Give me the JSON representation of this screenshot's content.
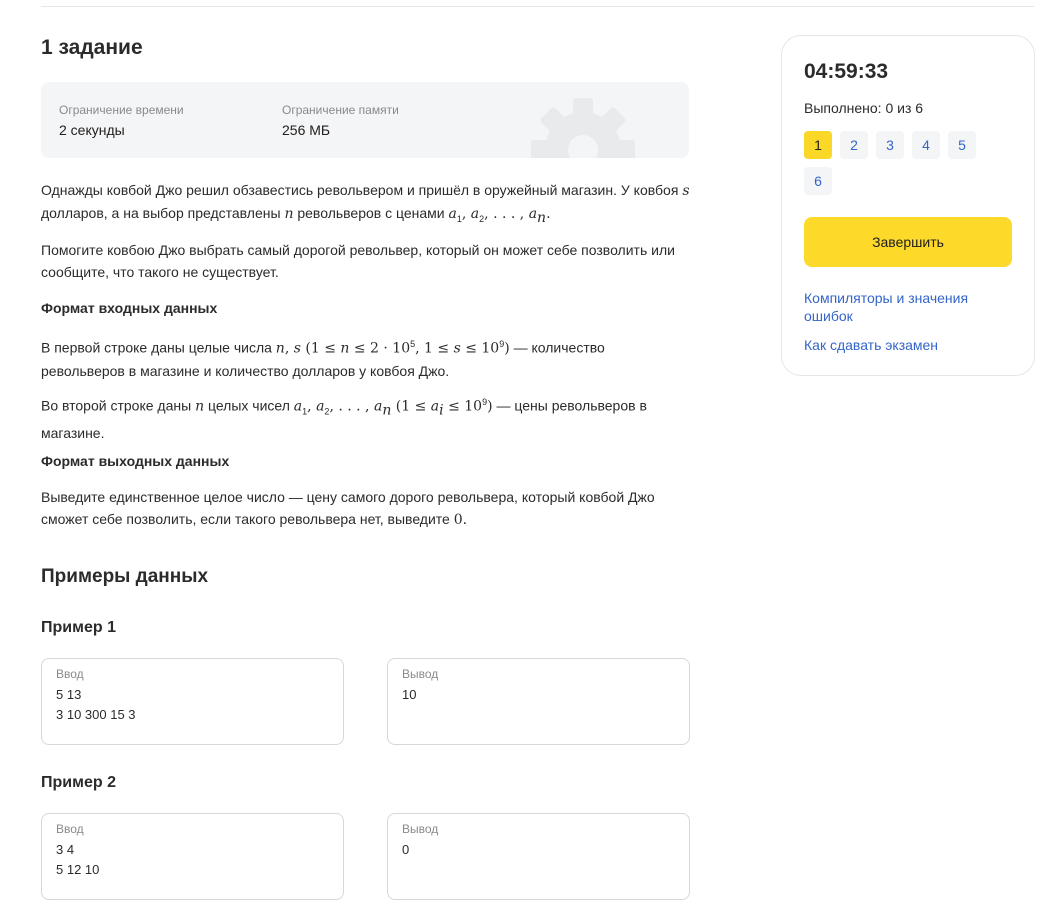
{
  "task": {
    "title": "1 задание",
    "limits": {
      "time_label": "Ограничение времени",
      "time_value": "2 секунды",
      "memory_label": "Ограничение памяти",
      "memory_value": "256 МБ"
    }
  },
  "statement": {
    "p1_a": "Однажды ковбой Джо решил обзавестись револьвером и пришёл в оружейный магазин. У ковбоя ",
    "p1_b": "долларов, а на выбор представлены ",
    "p1_c": " револьверов с ценами ",
    "p2": "Помогите ковбою Джо выбрать самый дорогой револьвер, который он может себе позволить или сообщите, что такого не существует.",
    "input_heading": "Формат входных данных",
    "p3_a": "В первой строке даны целые числа ",
    "p3_b": " — количество револьверов в магазине и количество долларов у ковбоя Джо.",
    "p4_a": "Во второй строке даны ",
    "p4_b": " целых чисел ",
    "p4_c": " — цены револьверов в магазине.",
    "output_heading": "Формат выходных данных",
    "p5": "Выведите единственное целое число — цену самого дорого револьвера, который ковбой Джо сможет себе позволить, если такого револьвера нет, выведите "
  },
  "examples": {
    "title": "Примеры данных",
    "input_label": "Ввод",
    "output_label": "Вывод",
    "items": [
      {
        "title": "Пример 1",
        "input_lines": [
          "5 13",
          "3 10 300 15 3"
        ],
        "output_lines": [
          "10"
        ]
      },
      {
        "title": "Пример 2",
        "input_lines": [
          "3 4",
          "5 12 10"
        ],
        "output_lines": [
          "0"
        ]
      }
    ]
  },
  "sidebar": {
    "timer": "04:59:33",
    "progress": "Выполнено: 0 из 6",
    "tasks": [
      "1",
      "2",
      "3",
      "4",
      "5",
      "6"
    ],
    "active_task": "1",
    "finish_label": "Завершить",
    "link_compilers": "Компиляторы и значения ошибок",
    "link_exam": "Как сдавать экзамен"
  },
  "colors": {
    "accent_yellow": "#fdd92a",
    "link_blue": "#3465c8",
    "panel_gray": "#f4f5f7"
  }
}
